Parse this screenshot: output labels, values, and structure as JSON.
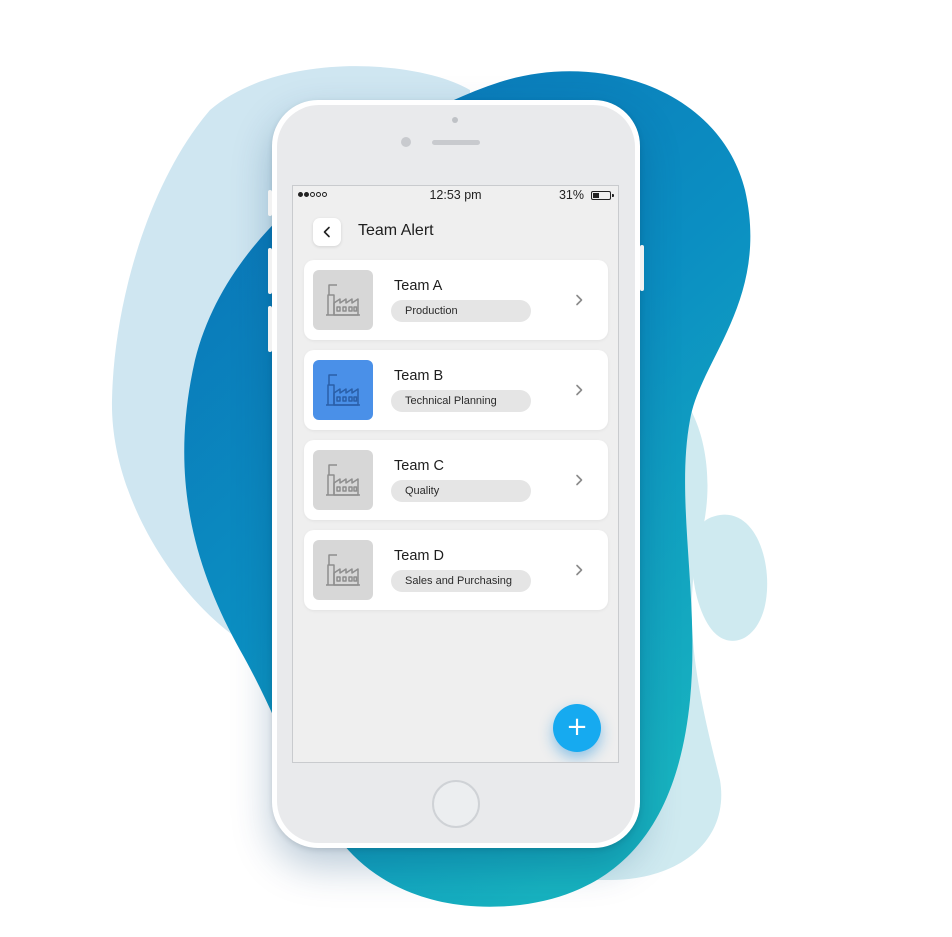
{
  "colors": {
    "accent": "#16aaf0",
    "active_thumb": "#4a90e8",
    "inactive_thumb": "#d7d7d7",
    "blob_dark": "#0b86bf",
    "blob_light": "#cfe6f1"
  },
  "status_bar": {
    "time": "12:53 pm",
    "battery": "31%",
    "signal_bars_filled": 2,
    "signal_bars_total": 5
  },
  "header": {
    "title": "Team Alert",
    "back_icon": "chevron-left-icon"
  },
  "teams": [
    {
      "name": "Team A",
      "department": "Production",
      "icon": "factory-icon",
      "active": false
    },
    {
      "name": "Team B",
      "department": "Technical Planning",
      "icon": "factory-icon",
      "active": true
    },
    {
      "name": "Team C",
      "department": "Quality",
      "icon": "factory-icon",
      "active": false
    },
    {
      "name": "Team D",
      "department": "Sales and Purchasing",
      "icon": "factory-icon",
      "active": false
    }
  ],
  "fab": {
    "label": "+",
    "icon": "plus-icon"
  }
}
